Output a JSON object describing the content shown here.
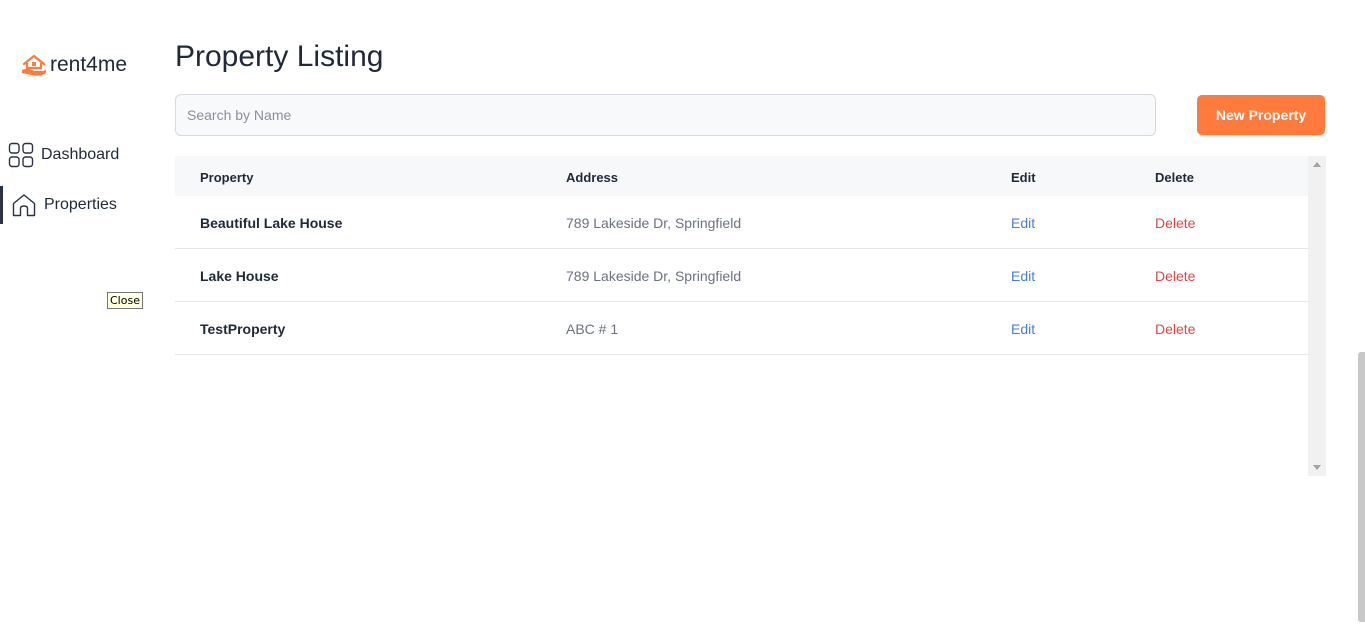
{
  "sidebar": {
    "logo_text": "rent4me",
    "items": [
      {
        "label": "Dashboard",
        "icon": "grid-icon",
        "active": false
      },
      {
        "label": "Properties",
        "icon": "home-icon",
        "active": true
      }
    ]
  },
  "tooltip": "Close",
  "main": {
    "title": "Property Listing",
    "search_placeholder": "Search by Name",
    "new_button": "New Property",
    "table": {
      "headers": [
        "Property",
        "Address",
        "Edit",
        "Delete"
      ],
      "rows": [
        {
          "name": "Beautiful Lake House",
          "address": "789 Lakeside Dr, Springfield",
          "edit": "Edit",
          "delete": "Delete"
        },
        {
          "name": "Lake House",
          "address": "789 Lakeside Dr, Springfield",
          "edit": "Edit",
          "delete": "Delete"
        },
        {
          "name": "TestProperty",
          "address": "ABC # 1",
          "edit": "Edit",
          "delete": "Delete"
        }
      ]
    }
  },
  "colors": {
    "accent": "#ff7a3d",
    "link": "#4a7fd6",
    "danger": "#e04848",
    "text": "#1f2937"
  }
}
